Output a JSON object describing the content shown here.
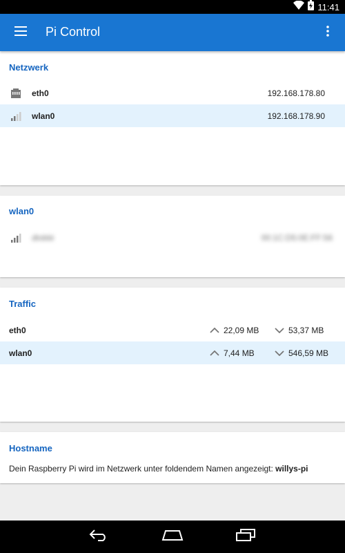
{
  "status_bar": {
    "time": "11:41"
  },
  "app_bar": {
    "title": "Pi Control"
  },
  "network": {
    "title": "Netzwerk",
    "rows": [
      {
        "name": "eth0",
        "ip": "192.168.178.80",
        "icon": "ethernet-icon"
      },
      {
        "name": "wlan0",
        "ip": "192.168.178.90",
        "icon": "wifi-signal-icon"
      }
    ]
  },
  "wlan": {
    "title": "wlan0",
    "ssid": "dlobbi",
    "mac": "00:1C:D5:0E:FF:56"
  },
  "traffic": {
    "title": "Traffic",
    "rows": [
      {
        "name": "eth0",
        "up": "22,09 MB",
        "down": "53,37 MB"
      },
      {
        "name": "wlan0",
        "up": "7,44 MB",
        "down": "546,59 MB"
      }
    ]
  },
  "hostname": {
    "title": "Hostname",
    "text": "Dein Raspberry Pi wird im Netzwerk unter foldendem Namen angezeigt: ",
    "name": "willys-pi"
  },
  "colors": {
    "app_bar": "#1976d2",
    "section_title": "#1565c0",
    "selected_row": "#e3f2fd"
  }
}
